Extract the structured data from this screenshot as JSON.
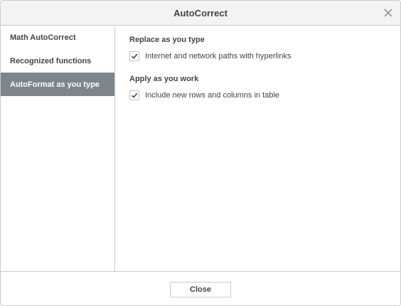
{
  "dialog": {
    "title": "AutoCorrect",
    "close_icon": "close-icon"
  },
  "sidebar": {
    "items": [
      {
        "label": "Math AutoCorrect",
        "active": false
      },
      {
        "label": "Recognized functions",
        "active": false
      },
      {
        "label": "AutoFormat as you type",
        "active": true
      }
    ]
  },
  "content": {
    "sections": [
      {
        "title": "Replace as you type",
        "options": [
          {
            "label": "Internet and network paths with hyperlinks",
            "checked": true
          }
        ]
      },
      {
        "title": "Apply as you work",
        "options": [
          {
            "label": "Include new rows and columns in table",
            "checked": true
          }
        ]
      }
    ]
  },
  "footer": {
    "close_label": "Close"
  },
  "colors": {
    "active_item_bg": "#7d858c",
    "border": "#cbcbcb",
    "titlebar_bg": "#f3f3f3",
    "text": "#444444"
  }
}
